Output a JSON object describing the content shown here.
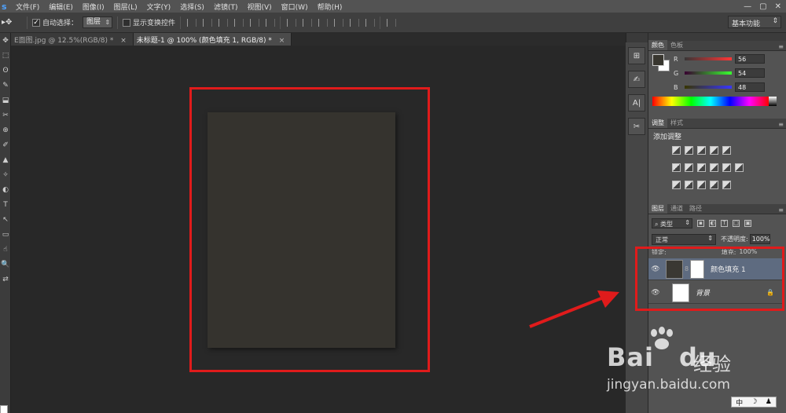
{
  "menubar": {
    "logo": "s",
    "items": [
      "文件(F)",
      "编辑(E)",
      "图像(I)",
      "图层(L)",
      "文字(Y)",
      "选择(S)",
      "滤镜(T)",
      "视图(V)",
      "窗口(W)",
      "帮助(H)"
    ],
    "window_controls": [
      "—",
      "▢",
      "✕"
    ]
  },
  "options": {
    "auto_select_label": "自动选择：",
    "auto_select_target": "图层",
    "show_transform_label": "显示变换控件",
    "workspace": "基本功能"
  },
  "tabs": [
    {
      "label": "E面图.jpg @ 12.5%(RGB/8) *",
      "close": "×",
      "active": false
    },
    {
      "label": "未标题-1 @ 100% (颜色填充 1, RGB/8) *",
      "close": "×",
      "active": true
    }
  ],
  "toolbar": {
    "tools": [
      "✥",
      "⬚",
      "ʘ",
      "✎",
      "⬓",
      "✂",
      "⊕",
      "✐",
      "▲",
      "✧",
      "◐",
      "T",
      "↖",
      "▭",
      "☝",
      "🔍",
      "⇄"
    ]
  },
  "strip": {
    "icons": [
      "⊞",
      "✍",
      "A|",
      "✂"
    ]
  },
  "color_panel": {
    "tabs": [
      "颜色",
      "色板"
    ],
    "fg_color": "#38362f",
    "channels": [
      {
        "label": "R",
        "value": "56",
        "gradient": "linear-gradient(to right,#383636,#ff3636)"
      },
      {
        "label": "G",
        "value": "54",
        "gradient": "linear-gradient(to right,#380030,#38ff30)"
      },
      {
        "label": "B",
        "value": "48",
        "gradient": "linear-gradient(to right,#383600,#3836ff)"
      }
    ]
  },
  "adjustments_panel": {
    "tabs": [
      "调整",
      "样式"
    ],
    "title": "添加调整"
  },
  "layers_panel": {
    "tabs": [
      "图层",
      "通道",
      "路径"
    ],
    "kind_filter": "类型",
    "blend_mode": "正常",
    "opacity_label": "不透明度:",
    "opacity_value": "100%",
    "lock_label": "锁定:",
    "fill_label": "填充:",
    "fill_value": "100%",
    "layers": [
      {
        "name": "颜色填充 1",
        "selected": true,
        "visible": "👁",
        "chain": "8"
      },
      {
        "name": "背景",
        "selected": false,
        "visible": "👁",
        "lock": "🔒"
      }
    ]
  },
  "watermark": {
    "brand": "Bai",
    "brand_du": "du",
    "jingyan": "经验",
    "url": "jingyan.baidu.com"
  },
  "ime": {
    "items": [
      "中",
      "☽",
      "♟"
    ]
  },
  "colors": {
    "highlight_red": "#e01b1b",
    "canvas_fill": "#35332e",
    "selected_layer": "#5e6b80"
  }
}
